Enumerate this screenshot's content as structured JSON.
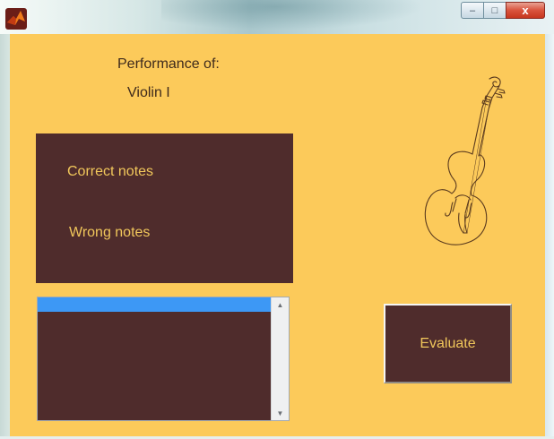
{
  "window": {
    "icon": "matlab-icon",
    "controls": {
      "minimize": "–",
      "maximize": "□",
      "close": "x"
    }
  },
  "labels": {
    "performance_of": "Performance of:",
    "instrument": "Violin I"
  },
  "results_panel": {
    "correct_label": "Correct notes",
    "wrong_label": "Wrong notes"
  },
  "listbox": {
    "items": [
      ""
    ],
    "selected_index": 0
  },
  "evaluate_button": {
    "label": "Evaluate"
  },
  "image": {
    "icon": "violin-icon"
  },
  "colors": {
    "background": "#fcca5a",
    "panel": "#4f2c2c",
    "panel_text": "#f1c75b",
    "selection": "#3d98f5"
  }
}
